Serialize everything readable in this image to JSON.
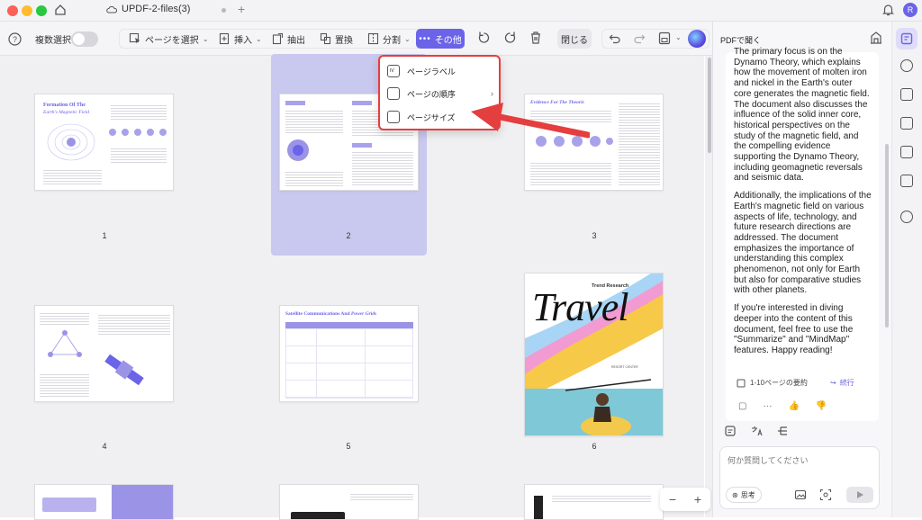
{
  "window": {
    "tab_title": "UPDF-2-files(3)",
    "avatar_initial": "R"
  },
  "toolbar": {
    "multi_select_label": "複数選択",
    "select_page_label": "ページを選択",
    "insert_label": "挿入",
    "extract_label": "抽出",
    "replace_label": "置換",
    "split_label": "分割",
    "more_label": "その他",
    "close_label": "閉じる"
  },
  "menu": {
    "items": [
      {
        "label": "ページラベル",
        "icon": "page-label-icon"
      },
      {
        "label": "ページの順序",
        "icon": "page-order-icon",
        "has_submenu": true
      },
      {
        "label": "ページサイズ",
        "icon": "page-size-icon"
      }
    ]
  },
  "pages": [
    {
      "number": "1",
      "title": "Formation Of The",
      "subtitle": "Earth's Magnetic Field"
    },
    {
      "number": "2",
      "title": "",
      "subtitle": ""
    },
    {
      "number": "3",
      "title": "Evidence For The Theoris",
      "subtitle": ""
    },
    {
      "number": "4",
      "title": "",
      "subtitle": ""
    },
    {
      "number": "5",
      "title": "Satellite Communications And",
      "subtitle": "Power Grids"
    },
    {
      "number": "6",
      "title": "Travel",
      "subtitle": "Trend Research",
      "footer": "RESORT CENTER"
    }
  ],
  "panel": {
    "header": "PDFで聞く",
    "paragraphs": [
      "The primary focus is on the Dynamo Theory, which explains how the movement of molten iron and nickel in the Earth's outer core generates the magnetic field. The document also discusses the influence of the solid inner core, historical perspectives on the study of the magnetic field, and the compelling evidence supporting the Dynamo Theory, including geomagnetic reversals and seismic data.",
      "Additionally, the implications of the Earth's magnetic field on various aspects of life, technology, and future research directions are addressed. The document emphasizes the importance of understanding this complex phenomenon, not only for Earth but also for comparative studies with other planets.",
      "If you're interested in diving deeper into the content of this document, feel free to use the \"Summarize\" and \"MindMap\" features. Happy reading!"
    ],
    "summary_label": "1-10ページの要約",
    "continue_label": "続行",
    "input_placeholder": "何か質問してください",
    "think_label": "思考"
  },
  "colors": {
    "accent": "#6b63e8",
    "highlight": "#e53e3e",
    "selection": "#c9c8ee"
  }
}
